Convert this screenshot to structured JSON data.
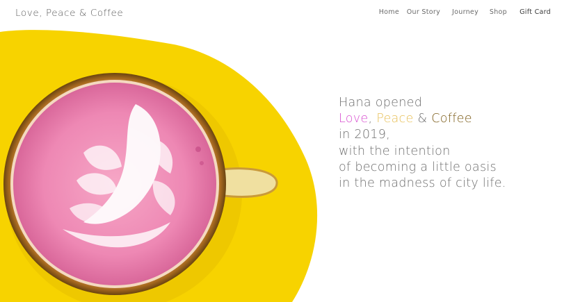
{
  "brand": {
    "name": "Love, Peace & Coffee"
  },
  "nav": {
    "items": [
      {
        "label": "Home"
      },
      {
        "label": "Our Story"
      },
      {
        "label": "Journey"
      },
      {
        "label": "Shop"
      },
      {
        "label": "Gift Card"
      }
    ]
  },
  "hero": {
    "image_description_icon": "latte-art-icon",
    "colors": {
      "background_blob": "#f7d300",
      "latte_pink": "#ec86b2",
      "foam": "#ffffff"
    }
  },
  "intro": {
    "line1": "Hana opened",
    "name_love": "Love",
    "name_sep1": ", ",
    "name_peace": "Peace",
    "name_sep2": " & ",
    "name_coffee": "Coffee",
    "line3": "in 2019,",
    "line4": "with the intention",
    "line5": "of becoming a little oasis",
    "line6": "in the madness of city life.",
    "colors": {
      "love": "#d84fd0",
      "peace": "#e8c15a",
      "coffee": "#7a5a16"
    }
  }
}
